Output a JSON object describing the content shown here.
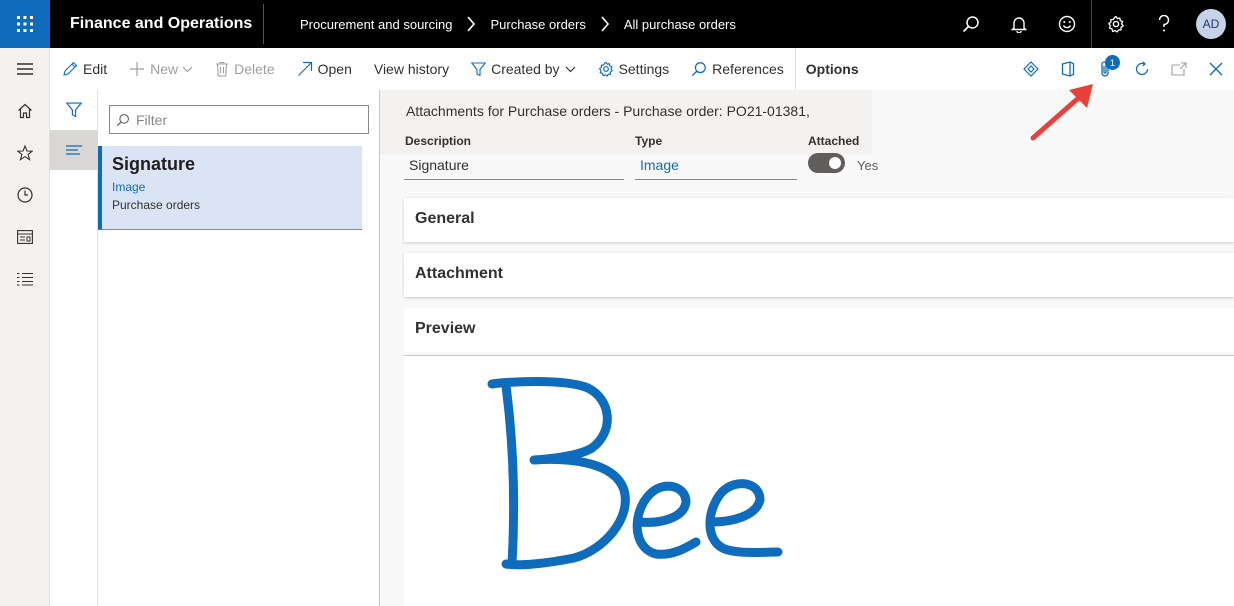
{
  "app": {
    "title": "Finance and Operations"
  },
  "breadcrumb": [
    "Procurement and sourcing",
    "Purchase orders",
    "All purchase orders"
  ],
  "user": {
    "initials": "AD"
  },
  "topbar_icons": [
    "search-icon",
    "bell-icon",
    "smiley-icon",
    "gear-icon",
    "help-icon"
  ],
  "actions": {
    "edit": "Edit",
    "new": "New",
    "delete": "Delete",
    "open": "Open",
    "view_history": "View history",
    "created_by": "Created by",
    "settings": "Settings",
    "references": "References",
    "options": "Options"
  },
  "attachments_badge": "1",
  "filter": {
    "placeholder": "Filter",
    "value": ""
  },
  "list": [
    {
      "title": "Signature",
      "type": "Image",
      "source": "Purchase orders"
    }
  ],
  "detail": {
    "caption": "Attachments for Purchase orders - Purchase order: PO21-01381,",
    "description_label": "Description",
    "description_value": "Signature",
    "type_label": "Type",
    "type_value": "Image",
    "attached_label": "Attached",
    "attached_value": "Yes",
    "attached_on": true
  },
  "fasttabs": [
    "General",
    "Attachment",
    "Preview"
  ],
  "colors": {
    "accent": "#0f6cbd",
    "topbar": "#000000",
    "annotation": "#e8413a",
    "signature": "#0f6cbd"
  }
}
